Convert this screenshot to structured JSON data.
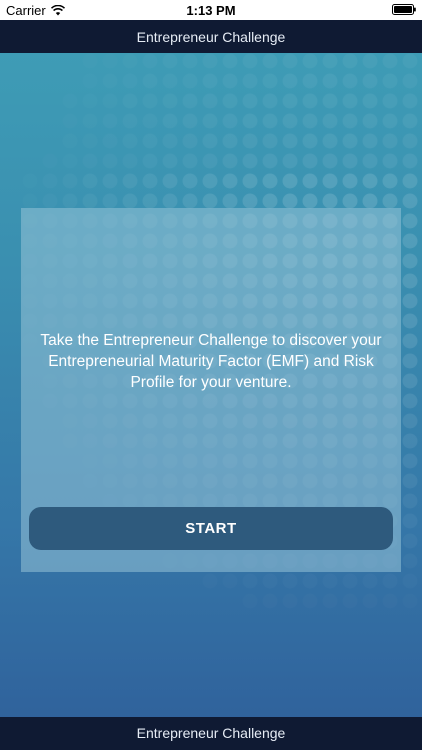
{
  "status_bar": {
    "carrier": "Carrier",
    "time": "1:13 PM",
    "wifi_icon": "wifi-icon",
    "battery_icon": "battery-icon"
  },
  "nav": {
    "title": "Entrepreneur Challenge"
  },
  "card": {
    "intro_text": "Take the Entrepreneur Challenge to discover your Entrepreneurial Maturity Factor (EMF) and Risk Profile for your venture.",
    "start_label": "START"
  },
  "footer": {
    "label": "Entrepreneur Challenge"
  },
  "colors": {
    "bar_background": "#0f1a33",
    "button": "#2e5a7d",
    "background_top": "#3f9fb7",
    "background_bottom": "#2f5f9a"
  }
}
